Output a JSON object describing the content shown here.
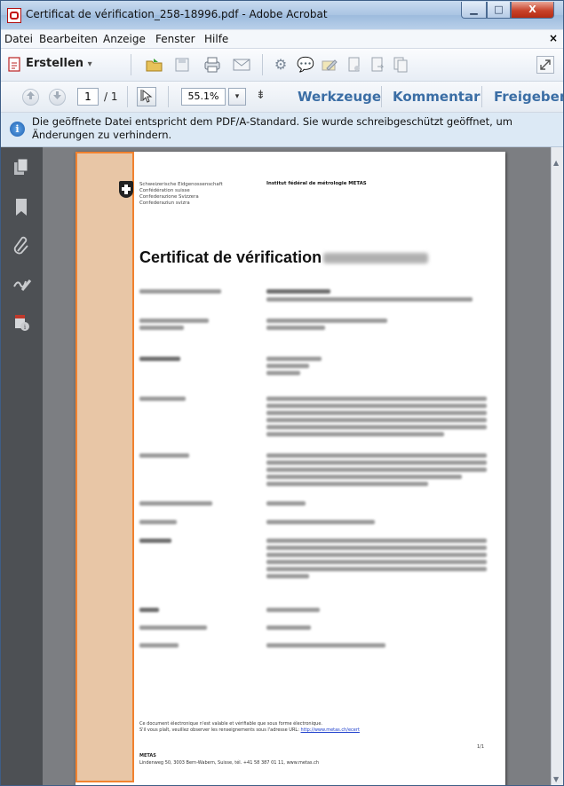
{
  "window": {
    "title": "Certificat de vérification_258-18996.pdf - Adobe Acrobat",
    "min_glyph": "▁",
    "max_glyph": "□",
    "close_glyph": "X"
  },
  "menu": {
    "items": [
      "Datei",
      "Bearbeiten",
      "Anzeige",
      "Fenster",
      "Hilfe"
    ],
    "close_glyph": "×"
  },
  "toolbar": {
    "create_label": "Erstellen",
    "create_arrow": "▾",
    "icons": [
      "create-pdf-icon",
      "open-folder-icon",
      "save-icon",
      "print-icon",
      "email-icon",
      "settings-gear-icon",
      "comment-bubble-icon",
      "sign-pen-icon",
      "document-icon",
      "document-export-icon",
      "document-combine-icon",
      "expand-icon"
    ]
  },
  "navigation": {
    "page_current": "1",
    "page_total": "/ 1",
    "zoom_value": "55.1%",
    "zoom_arrow": "▾",
    "fit_glyph": "⇟"
  },
  "panels": {
    "tools": "Werkzeuge",
    "comment": "Kommentar",
    "share": "Freigeben"
  },
  "infobar": {
    "icon_glyph": "i",
    "message": "Die geöffnete Datei entspricht dem PDF/A-Standard. Sie wurde schreibgeschützt geöffnet, um Änderungen zu verhindern."
  },
  "leftpane": {
    "icons": [
      "pages-icon",
      "bookmark-icon",
      "attachment-icon",
      "signature-icon",
      "document-info-icon"
    ]
  },
  "document": {
    "confederation": [
      "Schweizerische Eidgenossenschaft",
      "Confédération suisse",
      "Confederazione Svizzera",
      "Confederaziun svizra"
    ],
    "institute": "Institut fédéral de métrologie METAS",
    "title": "Certificat de vérification",
    "footer_line1": "Ce document électronique n'est valable et vérifiable que sous forme électronique.",
    "footer_line2_prefix": "S'il vous plaît, veuillez observer les renseignements sous l'adresse URL: ",
    "footer_link": "http://www.metas.ch/ecert",
    "footer_org": "METAS",
    "footer_address": "Lindenweg 50, 3003 Bern-Wabern, Suisse, tél. +41 58 387 01 11, www.metas.ch",
    "page_number": "1/1"
  }
}
